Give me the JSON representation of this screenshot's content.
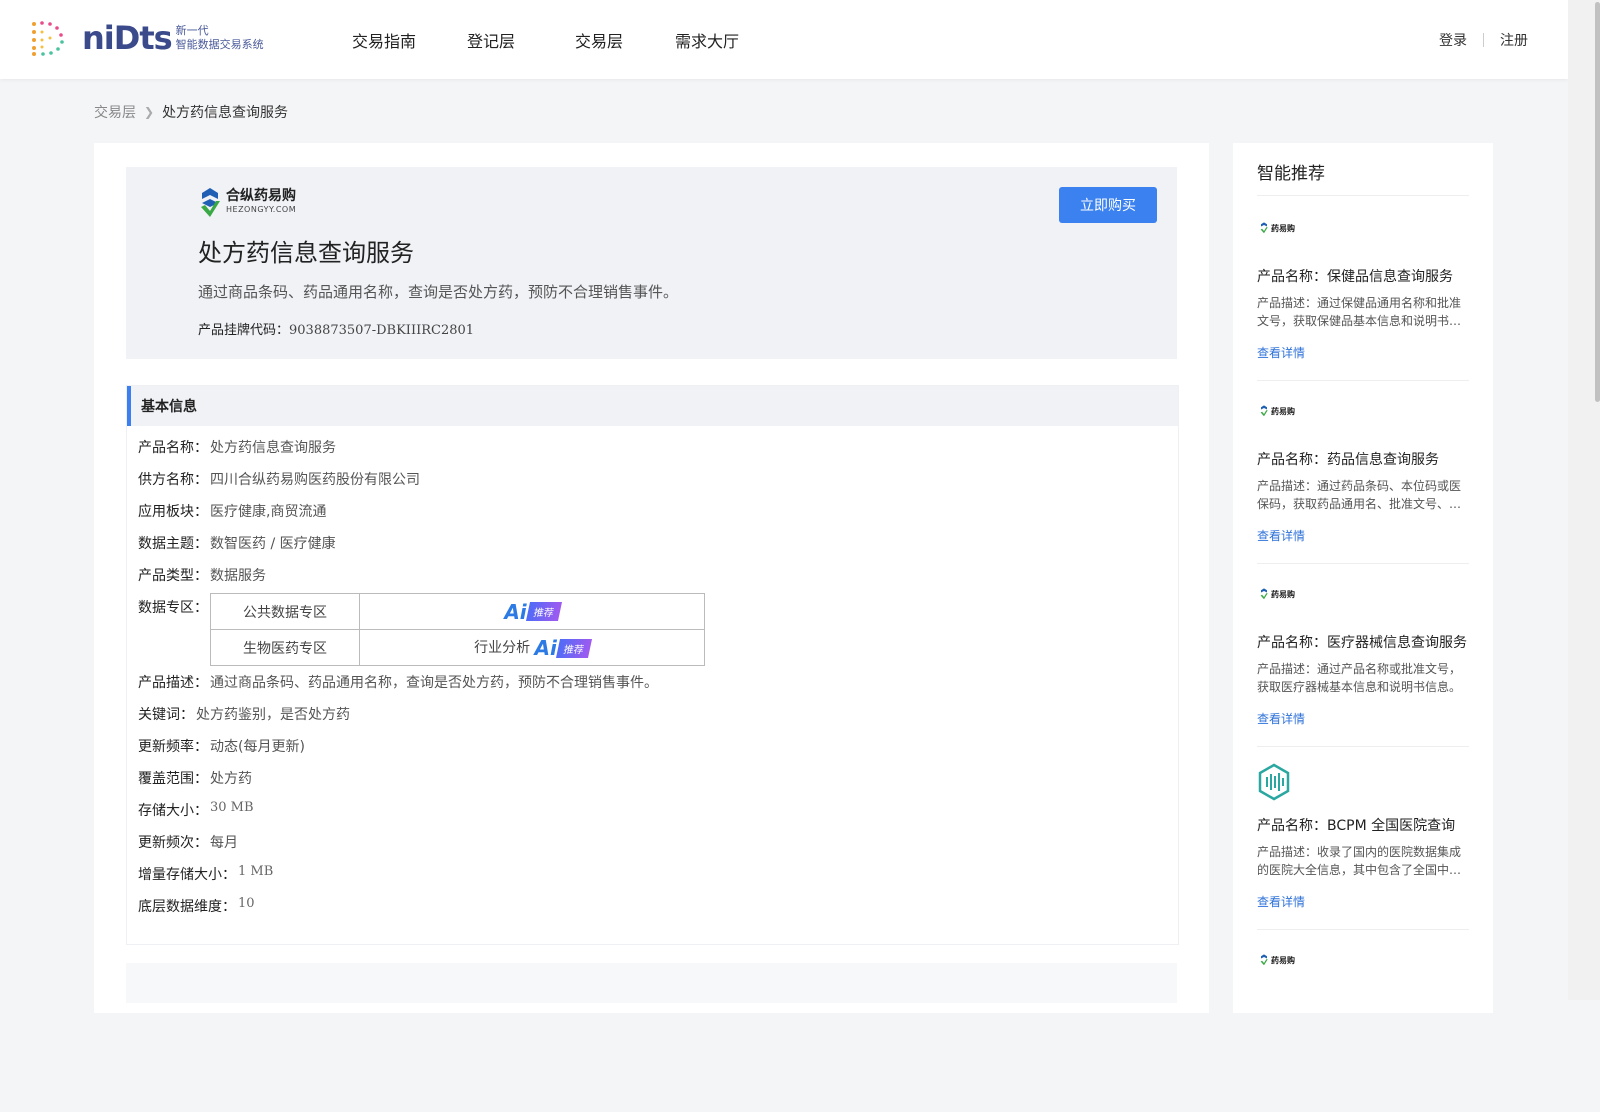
{
  "header": {
    "logo_text": "niDts",
    "logo_sub_1": "新一代",
    "logo_sub_2": "智能数据交易系统",
    "nav": [
      "交易指南",
      "登记层",
      "交易层",
      "需求大厅"
    ],
    "login": "登录",
    "register": "注册"
  },
  "breadcrumb": {
    "parent": "交易层",
    "current": "处方药信息查询服务"
  },
  "hero": {
    "brand_cn": "合纵药易购",
    "brand_en": "HEZONGYY.COM",
    "title": "处方药信息查询服务",
    "desc": "通过商品条码、药品通用名称，查询是否处方药，预防不合理销售事件。",
    "code_label": "产品挂牌代码：",
    "code_value": "9038873507-DBKIIIRC2801",
    "buy_label": "立即购买"
  },
  "basic": {
    "title": "基本信息",
    "product_name": {
      "label": "产品名称：",
      "value": "处方药信息查询服务"
    },
    "supplier": {
      "label": "供方名称：",
      "value": "四川合纵药易购医药股份有限公司"
    },
    "sector": {
      "label": "应用板块：",
      "value": "医疗健康,商贸流通"
    },
    "theme": {
      "label": "数据主题：",
      "value": "数智医药 / 医疗健康"
    },
    "type": {
      "label": "产品类型：",
      "value": "数据服务"
    },
    "zone_label": "数据专区：",
    "zones": [
      {
        "name": "公共数据专区",
        "tag_text": ""
      },
      {
        "name": "生物医药专区",
        "tag_text": "行业分析"
      }
    ],
    "ai_text": "Ai",
    "ai_rec": "推荐",
    "desc": {
      "label": "产品描述：",
      "value": "通过商品条码、药品通用名称，查询是否处方药，预防不合理销售事件。"
    },
    "keywords": {
      "label": "关键词：",
      "value": "处方药鉴别，是否处方药"
    },
    "freq": {
      "label": "更新频率：",
      "value": "动态(每月更新)"
    },
    "coverage": {
      "label": "覆盖范围：",
      "value": "处方药"
    },
    "storage": {
      "label": "存储大小：",
      "value": "30 MB"
    },
    "update_times": {
      "label": "更新频次：",
      "value": "每月"
    },
    "inc_storage": {
      "label": "增量存储大小：",
      "value": "1 MB"
    },
    "dimension": {
      "label": "底层数据维度：",
      "value": "10"
    }
  },
  "sidebar": {
    "title": "智能推荐",
    "link_label": "查看详情",
    "mini_brand": "药易购",
    "items": [
      {
        "name": "产品名称：保健品信息查询服务",
        "desc": "产品描述：通过保健品通用名称和批准文号，获取保健品基本信息和说明书信息。",
        "icon": "hezong-logo"
      },
      {
        "name": "产品名称：药品信息查询服务",
        "desc": "产品描述：通过药品条码、本位码或医保码，获取药品通用名、批准文号、生产企业等信息。",
        "icon": "hezong-logo"
      },
      {
        "name": "产品名称：医疗器械信息查询服务",
        "desc": "产品描述：通过产品名称或批准文号，获取医疗器械基本信息和说明书信息。",
        "icon": "hezong-logo"
      },
      {
        "name": "产品名称：BCPM 全国医院查询",
        "desc": "产品描述：收录了国内的医院数据集成的医院大全信息，其中包含了全国中医院等信息。",
        "icon": "hex-logo"
      },
      {
        "name": "",
        "desc": "",
        "icon": "hezong-logo"
      }
    ]
  }
}
